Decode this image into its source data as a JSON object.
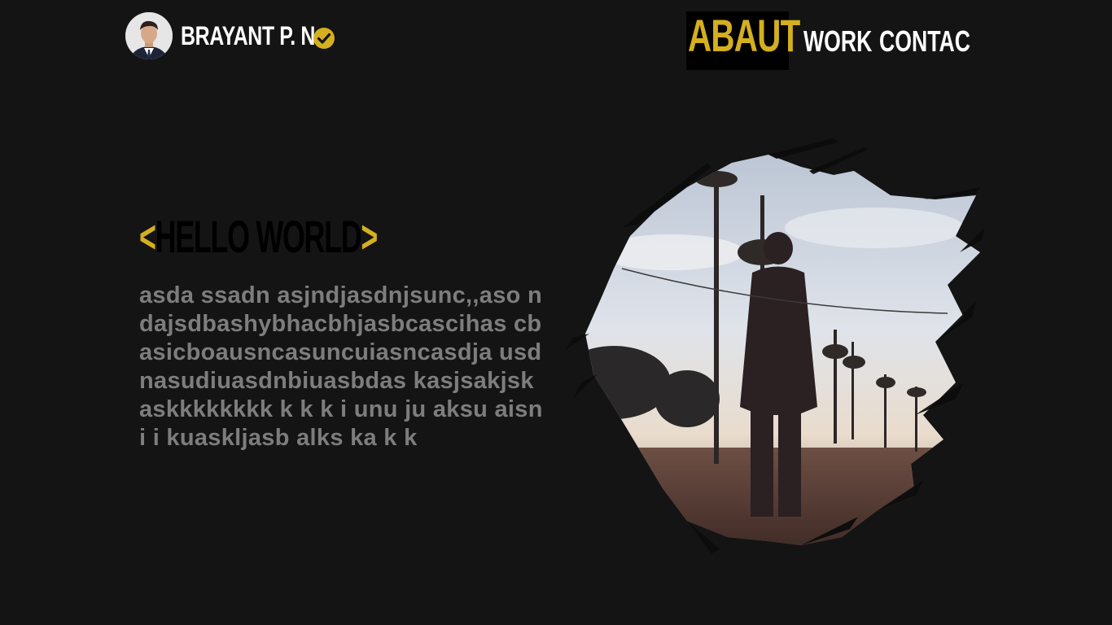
{
  "header": {
    "brand_name": "BRAYANT P. N",
    "avatar_icon": "user-avatar",
    "verified_icon": "check-circle-icon",
    "accent_color": "#d4af1f"
  },
  "nav": {
    "items": [
      {
        "label": "ABAUT",
        "active": true
      },
      {
        "label": "WORK",
        "active": false
      },
      {
        "label": "CONTAC",
        "active": false
      }
    ]
  },
  "hero": {
    "bracket_open": "<",
    "title": "HELLO WORLD",
    "bracket_close": ">",
    "text": "asda ssadn asjndjasdnjsunc,,aso ndajsdbashybhacbhjasbcascihas cbasicboausncasuncuiasncasdja usdnasudiuasdnbiuasbdas kasjsakjskaskkkkkkkk k k k i unu ju aksu aisni i kuaskljasb alks ka k k"
  },
  "colors": {
    "background": "#141414",
    "accent": "#d4af1f",
    "text_muted": "#7d7d7d",
    "white": "#ffffff"
  }
}
